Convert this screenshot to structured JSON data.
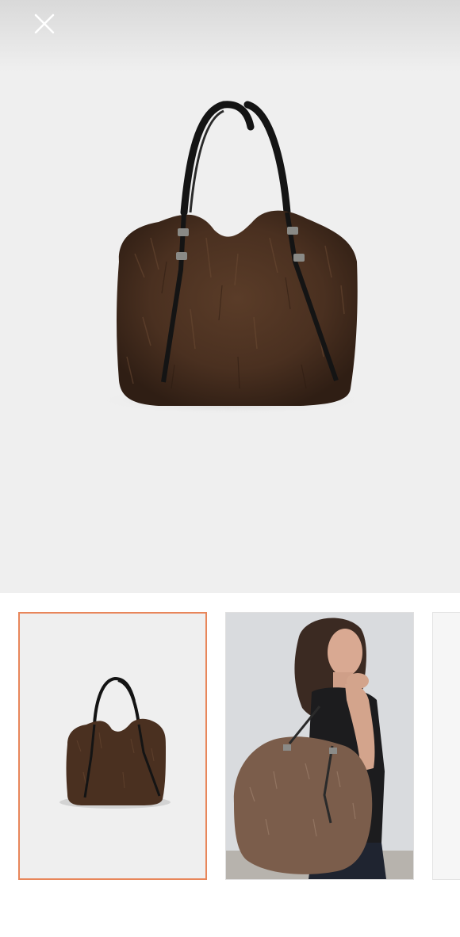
{
  "viewer": {
    "close_icon": "close-icon",
    "main_image": "fur-tote-bag-product-image",
    "selected_index": 0
  },
  "thumbnails": [
    {
      "name": "thumbnail-bag-product",
      "selected": true
    },
    {
      "name": "thumbnail-model-wearing-bag",
      "selected": false
    },
    {
      "name": "thumbnail-next-partial",
      "selected": false
    }
  ],
  "colors": {
    "accent_border": "#e8865a",
    "background": "#efefef",
    "fur": "#4a3020",
    "strap": "#141414"
  }
}
